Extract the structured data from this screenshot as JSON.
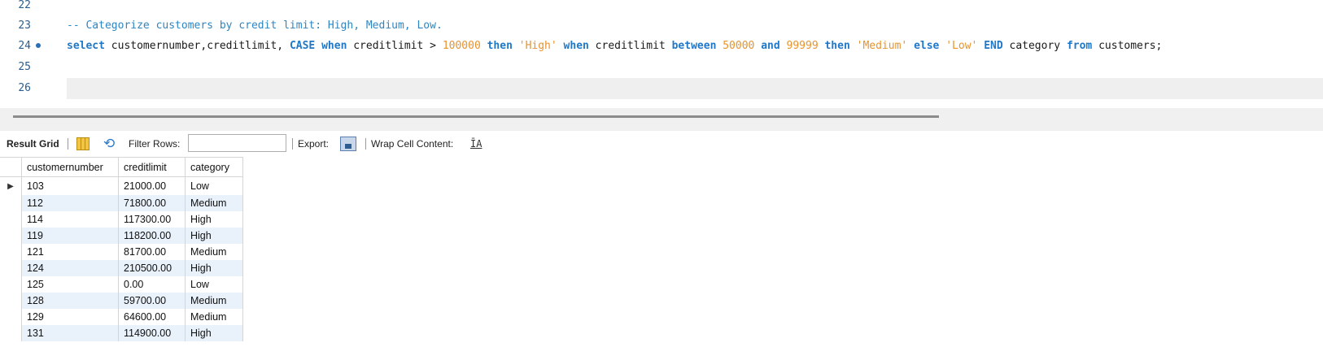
{
  "editor": {
    "lines": [
      {
        "num": "22",
        "text": ""
      },
      {
        "num": "23",
        "comment": "-- Categorize customers by credit limit: High, Medium, Low."
      },
      {
        "num": "24",
        "has_dot": true,
        "tokens": {
          "t1": "select",
          "t2": " customernumber,creditlimit, ",
          "t3": "CASE",
          "t4": " ",
          "t5": "when",
          "t6": " creditlimit > ",
          "t7": "100000",
          "t8": " ",
          "t9": "then",
          "t10": " ",
          "t11": "'High'",
          "t12": " ",
          "t13": "when",
          "t14": " creditlimit ",
          "t15": "between",
          "t16": " ",
          "t17": "50000",
          "t18": " ",
          "t19": "and",
          "t20": " ",
          "t21": "99999",
          "t22": " ",
          "t23": "then",
          "t24": " ",
          "t25": "'Medium'",
          "t26": " ",
          "t27": "else",
          "t28": " ",
          "t29": "'Low'",
          "t30": " ",
          "t31": "END",
          "t32": " category ",
          "t33": "from",
          "t34": " customers;"
        }
      },
      {
        "num": "25",
        "text": ""
      },
      {
        "num": "26",
        "text": ""
      }
    ]
  },
  "toolbar": {
    "result_grid_label": "Result Grid",
    "filter_rows_label": "Filter Rows:",
    "filter_value": "",
    "export_label": "Export:",
    "wrap_label": "Wrap Cell Content:",
    "wrap_icon_glyph": "ĪA"
  },
  "grid": {
    "columns": [
      "customernumber",
      "creditlimit",
      "category"
    ],
    "current_row_marker": "▶",
    "rows": [
      [
        "103",
        "21000.00",
        "Low"
      ],
      [
        "112",
        "71800.00",
        "Medium"
      ],
      [
        "114",
        "117300.00",
        "High"
      ],
      [
        "119",
        "118200.00",
        "High"
      ],
      [
        "121",
        "81700.00",
        "Medium"
      ],
      [
        "124",
        "210500.00",
        "High"
      ],
      [
        "125",
        "0.00",
        "Low"
      ],
      [
        "128",
        "59700.00",
        "Medium"
      ],
      [
        "129",
        "64600.00",
        "Medium"
      ],
      [
        "131",
        "114900.00",
        "High"
      ]
    ]
  },
  "colors": {
    "keyword": "#1f78c8",
    "number_literal": "#e8932b",
    "string_literal": "#e8932b",
    "comment": "#2e86c1",
    "row_alt": "#e9f1fb"
  }
}
